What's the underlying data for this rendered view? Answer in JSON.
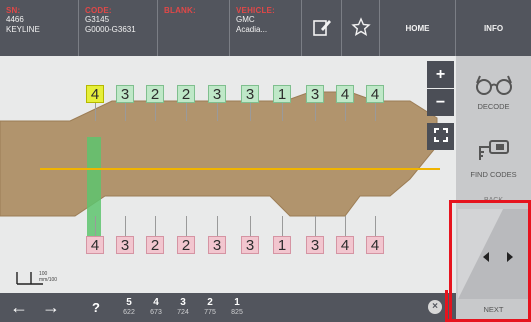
{
  "header": {
    "sn_label": "SN:",
    "sn_value_1": "4466",
    "sn_value_2": "KEYLINE",
    "code_label": "CODE:",
    "code_value_1": "G3145",
    "code_value_2": "G0000-G3631",
    "blank_label": "BLANK:",
    "vehicle_label": "VEHICLE:",
    "vehicle_value_1": "GMC",
    "vehicle_value_2": "Acadia...",
    "home_label": "HOME",
    "info_label": "INFO"
  },
  "side": {
    "decode_label": "DECODE",
    "find_codes_label": "FIND CODES",
    "back_label": "BACK",
    "next_label": "NEXT"
  },
  "zoom": {
    "plus": "+",
    "minus": "−"
  },
  "key": {
    "top_cuts": [
      "4",
      "3",
      "2",
      "2",
      "3",
      "3",
      "1",
      "3",
      "4",
      "4"
    ],
    "bottom_cuts": [
      "4",
      "3",
      "2",
      "2",
      "3",
      "3",
      "1",
      "3",
      "4",
      "4"
    ],
    "selected_index": 0,
    "scale_value": "100",
    "scale_unit": "mm/100"
  },
  "bottom": {
    "question": "?",
    "cuts": [
      {
        "depth": "5",
        "pos": "622"
      },
      {
        "depth": "4",
        "pos": "673"
      },
      {
        "depth": "3",
        "pos": "724"
      },
      {
        "depth": "2",
        "pos": "775"
      },
      {
        "depth": "1",
        "pos": "825"
      }
    ]
  },
  "colors": {
    "highlight": "#e6141e",
    "key_body": "#b1946d",
    "center_line": "#f0b400"
  }
}
